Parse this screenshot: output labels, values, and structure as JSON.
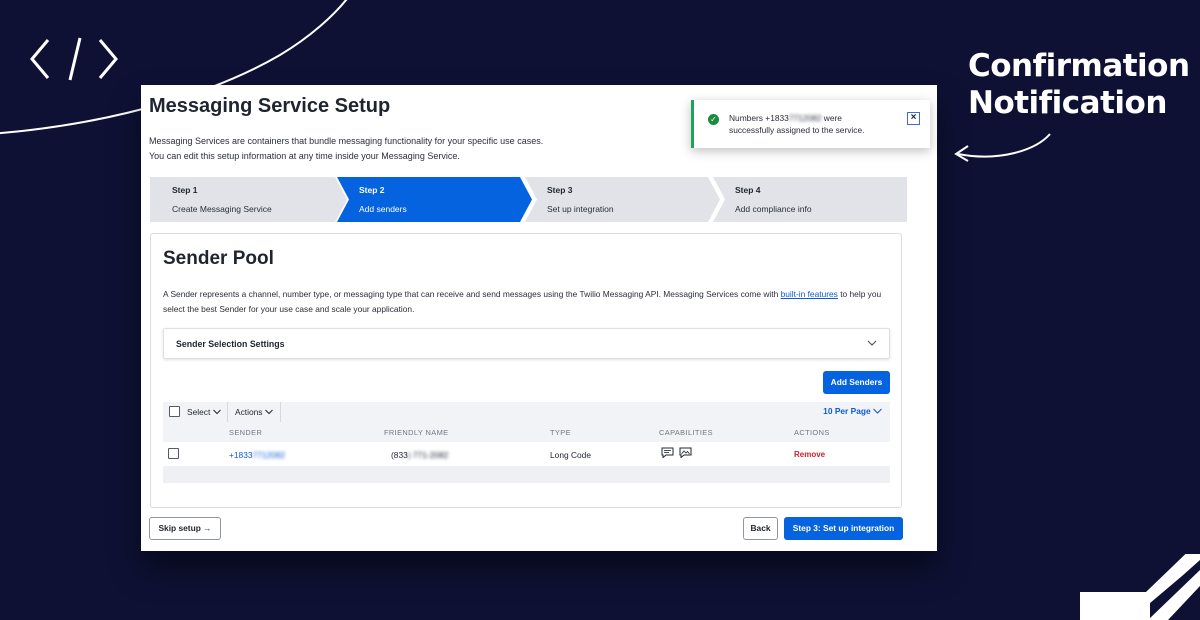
{
  "callout": {
    "line1": "Confirmation",
    "line2": "Notification"
  },
  "colors": {
    "background": "#0e1134",
    "accent_blue": "#0563e0",
    "success_green": "#1fa35a",
    "remove_red": "#d0202f",
    "step_inactive": "#e1e3e8"
  },
  "toast": {
    "icon": "check-circle-icon",
    "text_prefix": "Numbers +1833",
    "text_blurred": "7712082",
    "text_mid": " were",
    "text_line2_a": "successfully assigned t",
    "text_line2_b": "o the service.",
    "close": "×"
  },
  "page": {
    "title": "Messaging Service Setup",
    "intro_line1": "Messaging Services are containers that bundle messaging functionality for your specific use cases.",
    "intro_line2": "You can edit this setup information at any time inside your Messaging Service."
  },
  "steps": [
    {
      "num": "Step 1",
      "label": "Create Messaging Service",
      "active": false
    },
    {
      "num": "Step 2",
      "label": "Add senders",
      "active": true
    },
    {
      "num": "Step 3",
      "label": "Set up integration",
      "active": false
    },
    {
      "num": "Step 4",
      "label": "Add compliance info",
      "active": false
    }
  ],
  "sender_pool": {
    "title": "Sender Pool",
    "desc_before": "A Sender represents a channel, number type, or messaging type that can receive and send messages using the Twilio Messaging API. Messaging Services come with ",
    "desc_link": "built-in features",
    "desc_after": " to help you select the best Sender for your use case and scale your application.",
    "accordion_label": "Sender Selection Settings",
    "add_button": "Add Senders",
    "toolbar": {
      "select": "Select",
      "actions": "Actions",
      "per_page": "10 Per Page"
    },
    "columns": [
      "SENDER",
      "FRIENDLY NAME",
      "TYPE",
      "CAPABILITIES",
      "ACTIONS"
    ],
    "rows": [
      {
        "sender_prefix": "+1833",
        "sender_blurred": "7712082",
        "friendly_prefix": "(833",
        "friendly_blurred": ") 771-2082",
        "type": "Long Code",
        "capabilities": [
          "sms-icon",
          "mms-icon"
        ],
        "action": "Remove"
      }
    ]
  },
  "footer": {
    "skip": "Skip setup",
    "skip_arrow": "→",
    "back": "Back",
    "next": "Step 3: Set up integration"
  }
}
